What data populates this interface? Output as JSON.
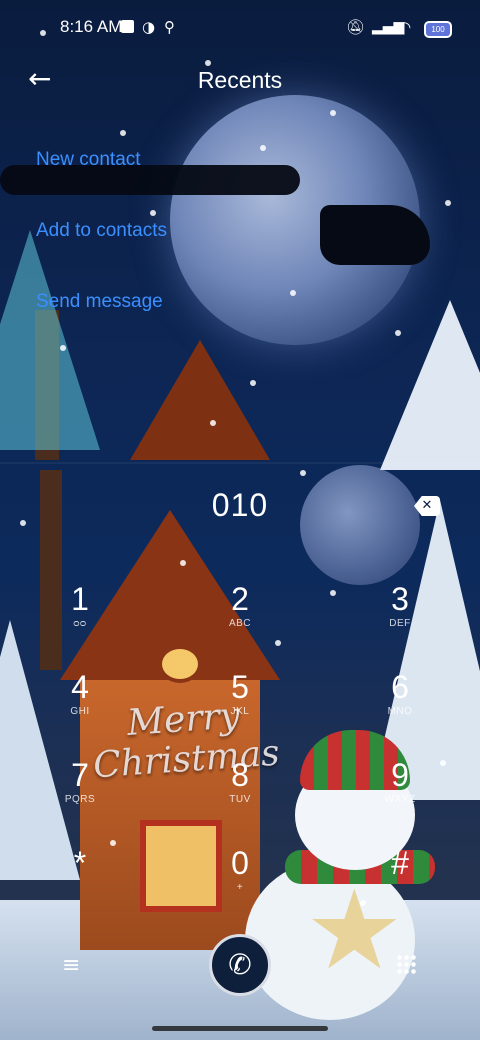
{
  "status_bar": {
    "time": "8:16 AM",
    "battery_level": "100",
    "left_icons": [
      "square-notification-icon",
      "circle-badge-icon",
      "location-icon"
    ],
    "right_icons": [
      "mute-icon",
      "signal-icon",
      "wifi-icon",
      "battery-icon"
    ]
  },
  "header": {
    "title": "Recents",
    "back_icon": "arrow-left-icon"
  },
  "actions": {
    "new_contact": "New contact",
    "add_to_contacts": "Add to contacts",
    "send_message": "Send message"
  },
  "dialer": {
    "number": "010",
    "keys": [
      {
        "digit": "1",
        "letters": "ᴑᴑ"
      },
      {
        "digit": "2",
        "letters": "ABC"
      },
      {
        "digit": "3",
        "letters": "DEF"
      },
      {
        "digit": "4",
        "letters": "GHI"
      },
      {
        "digit": "5",
        "letters": "JKL"
      },
      {
        "digit": "6",
        "letters": "MNO"
      },
      {
        "digit": "7",
        "letters": "PQRS"
      },
      {
        "digit": "8",
        "letters": "TUV"
      },
      {
        "digit": "9",
        "letters": "WXYZ"
      },
      {
        "digit": "*",
        "letters": ""
      },
      {
        "digit": "0",
        "letters": "+"
      },
      {
        "digit": "#",
        "letters": ""
      }
    ]
  },
  "wallpaper": {
    "greeting": "Merry Christmas"
  },
  "colors": {
    "accent": "#3b8fff",
    "background": "#0c2a5c"
  }
}
